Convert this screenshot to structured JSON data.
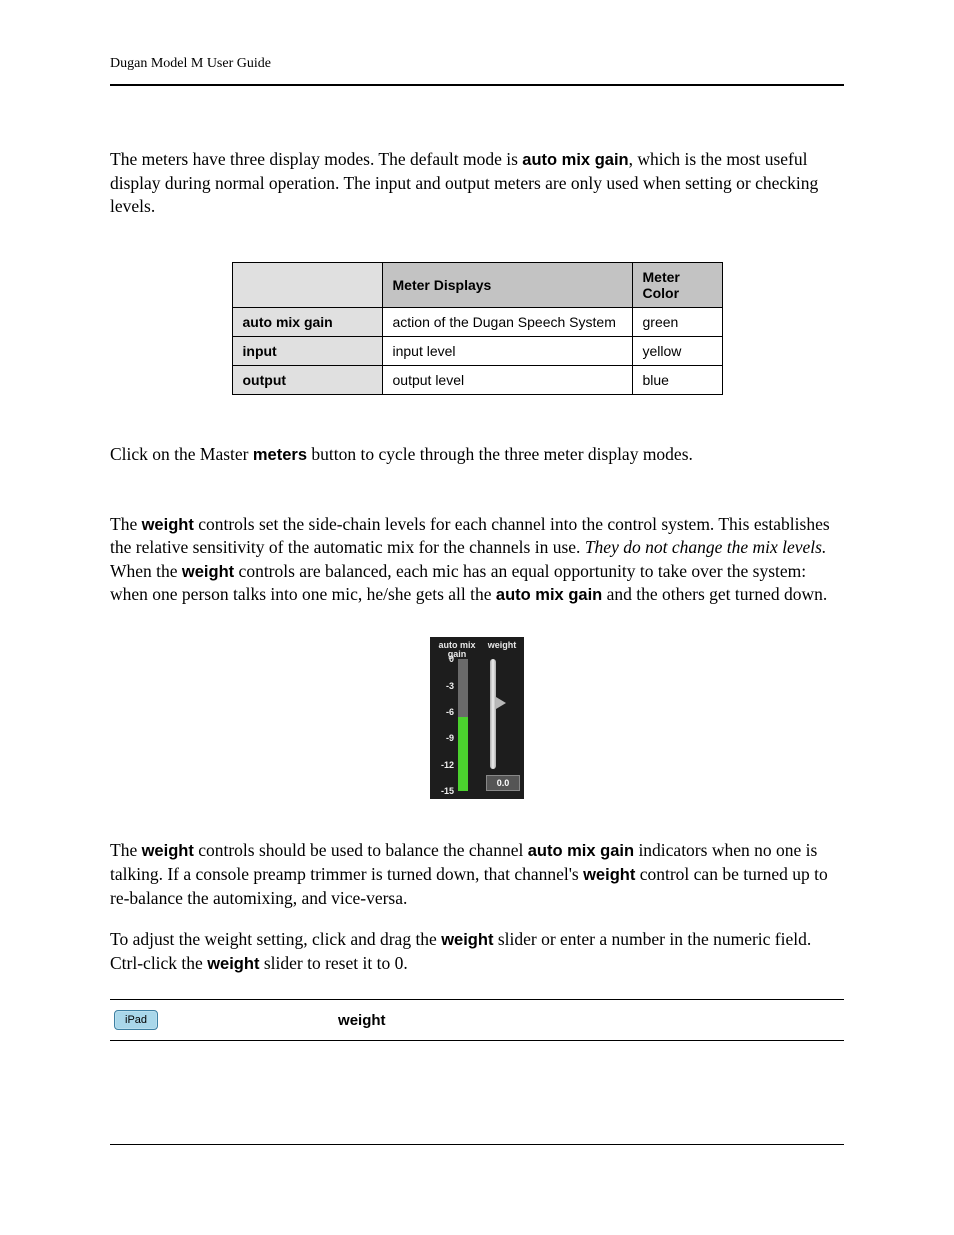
{
  "header": {
    "title": "Dugan Model M User Guide"
  },
  "para1": {
    "pre": "The meters have three display modes. The default mode is ",
    "b1": "auto mix gain",
    "post": ", which is the most useful display during normal operation. The input and output meters are only used when setting or checking levels."
  },
  "table": {
    "h_displays": "Meter Displays",
    "h_color": "Meter Color",
    "rows": [
      {
        "label": "auto mix gain",
        "displays": "action of the Dugan Speech System",
        "color": "green"
      },
      {
        "label": "input",
        "displays": "input level",
        "color": "yellow"
      },
      {
        "label": "output",
        "displays": "output level",
        "color": "blue"
      }
    ]
  },
  "para2": {
    "pre": "Click on the Master ",
    "b1": "meters",
    "post": " button to cycle through the three meter display modes."
  },
  "para3": {
    "s1": "The ",
    "b1": "weight",
    "s2": " controls set the side-chain levels for each channel into the control system. This establishes the relative sensitivity of the automatic mix for the channels in use. ",
    "i1": "They do not change the mix levels.",
    "s3": " When the ",
    "b2": "weight",
    "s4": " controls are balanced, each mic has an equal opportunity to take over the system: when one person talks into one mic, he/she gets all the ",
    "b3": "auto mix gain",
    "s5": " and the others get turned down."
  },
  "figure": {
    "amg_label": "auto mix\ngain",
    "weight_label": "weight",
    "ticks": [
      "0",
      "-3",
      "-6",
      "-9",
      "-12",
      "-15"
    ],
    "readout": "0.0"
  },
  "para4": {
    "s1": "The ",
    "b1": "weight",
    "s2": " controls should be used to balance the channel ",
    "b2": "auto mix gain",
    "s3": " indicators when no one is talking. If a console preamp trimmer is turned down, that channel's ",
    "b3": "weight",
    "s4": " control can be turned up to re-balance the automixing, and vice-versa."
  },
  "para5": {
    "s1": "To adjust the weight setting, click and drag the ",
    "b1": "weight",
    "s2": " slider or enter a number in the numeric field. Ctrl-click the ",
    "b2": "weight",
    "s3": " slider to reset it to 0."
  },
  "note": {
    "badge": "iPad",
    "text": "weight"
  }
}
